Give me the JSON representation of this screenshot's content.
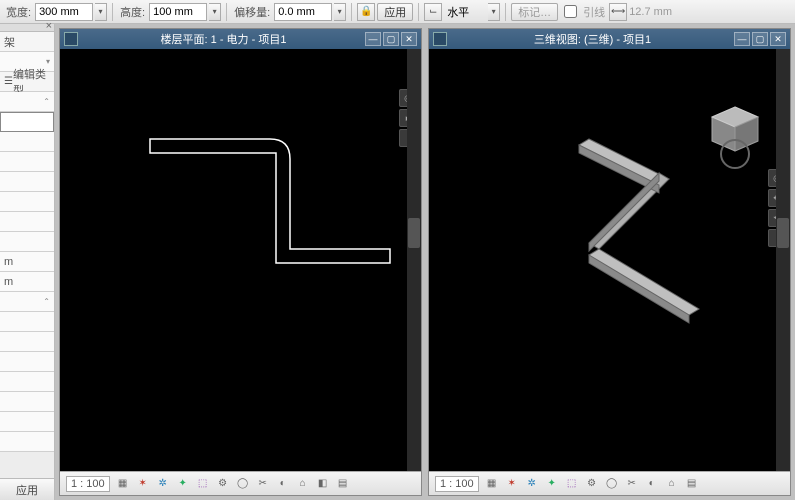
{
  "toolbar": {
    "width_label": "宽度:",
    "width_value": "300 mm",
    "height_label": "高度:",
    "height_value": "100 mm",
    "offset_label": "偏移量:",
    "offset_value": "0.0 mm",
    "apply_label": "应用",
    "justify_label": "水平",
    "tag_label": "标记…",
    "leader_label": "引线",
    "leader_dim": "12.7 mm"
  },
  "sidebar": {
    "r1": "架",
    "r_edit": "编辑类型",
    "unit_suffix": "m",
    "apply_btn": "应用"
  },
  "views": {
    "left": {
      "title": "楼层平面: 1 - 电力 - 项目1",
      "scale": "1 : 100"
    },
    "right": {
      "title": "三维视图: (三维) - 项目1",
      "scale": "1 : 100"
    }
  }
}
